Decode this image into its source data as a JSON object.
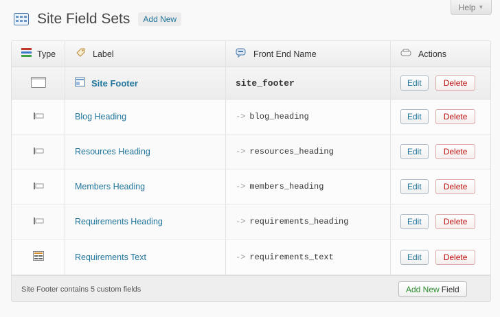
{
  "help": {
    "label": "Help",
    "arrow": "▼"
  },
  "header": {
    "title": "Site Field Sets",
    "add_new": "Add New"
  },
  "columns": {
    "type": "Type",
    "label": "Label",
    "front_end_name": "Front End Name",
    "actions": "Actions"
  },
  "set_row": {
    "label": "Site Footer",
    "front_end_name": "site_footer",
    "edit": "Edit",
    "delete": "Delete"
  },
  "fields": [
    {
      "icon": "heading-field-icon",
      "label": "Blog Heading",
      "arrow": "->",
      "front_end_name": "blog_heading",
      "edit": "Edit",
      "delete": "Delete"
    },
    {
      "icon": "heading-field-icon",
      "label": "Resources Heading",
      "arrow": "->",
      "front_end_name": "resources_heading",
      "edit": "Edit",
      "delete": "Delete"
    },
    {
      "icon": "heading-field-icon",
      "label": "Members Heading",
      "arrow": "->",
      "front_end_name": "members_heading",
      "edit": "Edit",
      "delete": "Delete"
    },
    {
      "icon": "heading-field-icon",
      "label": "Requirements Heading",
      "arrow": "->",
      "front_end_name": "requirements_heading",
      "edit": "Edit",
      "delete": "Delete"
    },
    {
      "icon": "text-field-icon",
      "label": "Requirements Text",
      "arrow": "->",
      "front_end_name": "requirements_text",
      "edit": "Edit",
      "delete": "Delete"
    }
  ],
  "footer": {
    "summary": "Site Footer contains 5 custom fields",
    "add_field_green": "Add New",
    "add_field_rest": "Field"
  },
  "colors": {
    "link": "#21759b",
    "delete": "#bc0b0b",
    "add_green": "#2d8a2d"
  }
}
